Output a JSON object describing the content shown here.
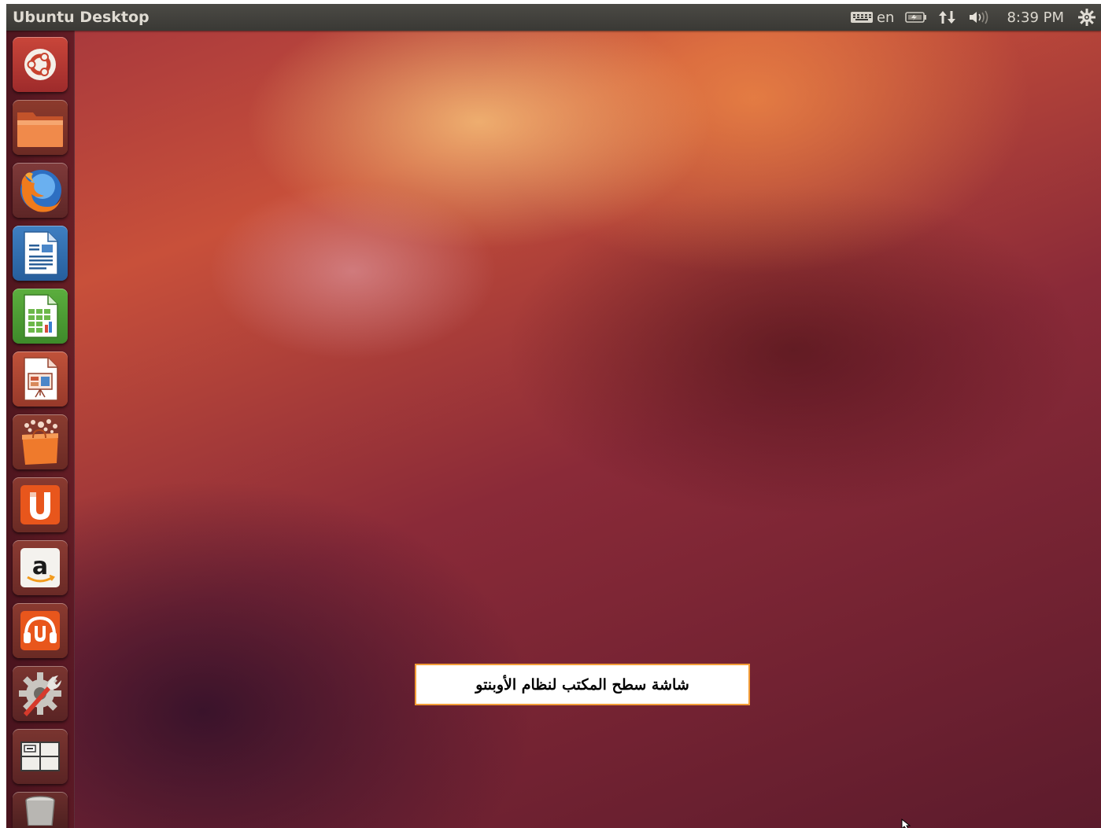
{
  "top_panel": {
    "title": "Ubuntu Desktop",
    "indicators": {
      "keyboard_layout": "en",
      "clock": "8:39 PM",
      "icons": [
        "keyboard-icon",
        "battery-icon",
        "network-icon",
        "volume-icon",
        "session-gear-icon"
      ]
    }
  },
  "launcher": {
    "items": [
      {
        "name": "dash-home",
        "icon": "ubuntu-logo-icon"
      },
      {
        "name": "home-folder",
        "icon": "folder-icon"
      },
      {
        "name": "firefox",
        "icon": "firefox-icon"
      },
      {
        "name": "libreoffice-writer",
        "icon": "writer-document-icon"
      },
      {
        "name": "libreoffice-calc",
        "icon": "calc-spreadsheet-icon"
      },
      {
        "name": "libreoffice-impress",
        "icon": "impress-presentation-icon"
      },
      {
        "name": "ubuntu-software-center",
        "icon": "shopping-bag-icon"
      },
      {
        "name": "ubuntu-one",
        "icon": "ubuntu-one-icon"
      },
      {
        "name": "amazon",
        "icon": "amazon-icon"
      },
      {
        "name": "ubuntu-one-music",
        "icon": "music-headphones-icon"
      },
      {
        "name": "system-settings",
        "icon": "settings-wrench-icon"
      },
      {
        "name": "workspace-switcher",
        "icon": "workspaces-icon"
      },
      {
        "name": "trash",
        "icon": "trash-icon"
      }
    ]
  },
  "caption": {
    "text": "شاشة سطح المكتب لنظام الأوبنتو"
  },
  "colors": {
    "panel": "#3f3e3a",
    "caption_border": "#f29d38",
    "ubuntu_orange": "#dd4814"
  }
}
